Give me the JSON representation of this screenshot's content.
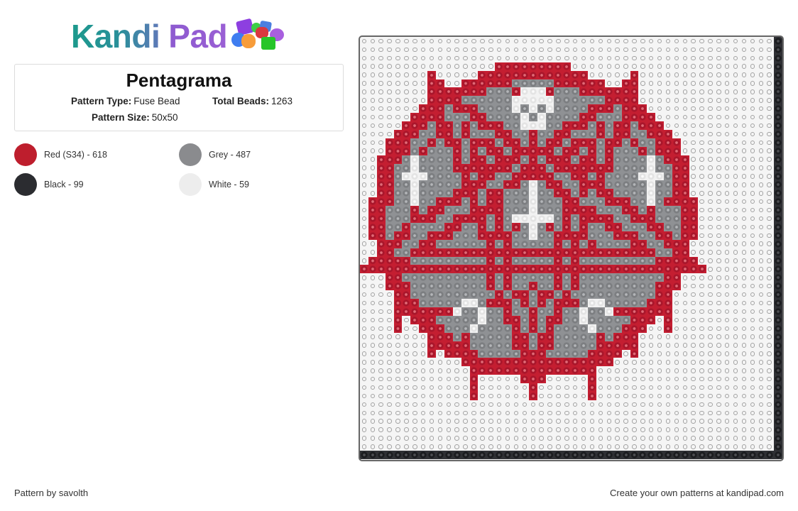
{
  "logo": {
    "part1": "Kandi",
    "part2": "Pad"
  },
  "pattern": {
    "title": "Pentagrama",
    "type_label": "Pattern Type:",
    "type_value": "Fuse Bead",
    "total_label": "Total Beads:",
    "total_value": "1263",
    "size_label": "Pattern Size:",
    "size_value": "50x50"
  },
  "legend": {
    "separator": " - ",
    "items": [
      {
        "key": "R",
        "name": "Red (S34)",
        "count": "618",
        "hex": "#be1e2d"
      },
      {
        "key": "G",
        "name": "Grey",
        "count": "487",
        "hex": "#8a8b8e"
      },
      {
        "key": "K",
        "name": "Black",
        "count": "99",
        "hex": "#2b2c30"
      },
      {
        "key": "W",
        "name": "White",
        "count": "59",
        "hex": "#ededed"
      }
    ]
  },
  "board": {
    "columns": 50,
    "rows_count": 50,
    "key": {
      ".": "empty",
      "R": "Red (S34)",
      "G": "Grey",
      "W": "White",
      "K": "Black"
    },
    "rows": [
      ".......... .......... .......... .......... .........K",
      ".......... .......... .......... .......... .........K",
      ".......... .......... .......... .......... .........K",
      ".......... ......RRRR RRRRR..... .......... .........K",
      "........R. ....RRRRRR RRRRRRR... ..R....... .........K",
      "........RR ..RRRRRRGG GGGRRRRRR. .RR....... .........K",
      "........RR RRRRRGGGRW WWRGGGRRRR RRR....... .........K",
      "........RR RRGGGGGGWW WWWGGGGGGR RRR....... .........K",
      ".......RRR GRRRGGGGWG WGWGGGGRRR GRRR...... .........K",
      "......RRRR GGGRRGGGGW GWGGGGRRGG GRRRR..... .........K",
      ".....RRRGR RGRGRRRGGW WWGGRRRGRG RRGRRR.... .........K",
      "....RRRGGR RGRGGGRRGG RGGRRGGGRG RRGGRRR... .........K",
      "...RRRGGRG RRGRRRGRRG RGRRGRRRGR RGRGGRRR.. .........K",
      "...RRRGRGG GRGRGRRGRR RRRGRRGRGR GGGRGRRR.. .........K",
      "..RRRGWGGG GRGRRGRRRG RGRRRGRRGR GGGGWGRRR. .........K",
      "..RRGGWGGG GRRRRRRRGR RRGRRRRRRR GGGGWGGRR. .........K",
      "..RRGWWWGG GGRGRRGGRR RRRGGRRGRG GGGWWWGRR. .........K",
      "..RRGGWGGG GGRRRGGRRG WGRRGGRRRG GGGGWGGRR. .........K",
      "..RRGGWGGG GRRRGRRGGG WGGRRGRGRR GGGGWGGRR. .........K",
      ".RRRGGWGGR RRGRGRRGGG WGGGRRGGGR RRGGWGRRRR .........K",
      ".RRGGGRGRR GGGRRRRGGG WGGGRRRRGG GRRGRGGGRR .........K",
      ".RRGGGRRRG GRRRRGRGWW WWWGRGRRRR GGRRRGGGRR .........K",
      ".RRGGRGGGG RRGGRGRGRG WGRGRGRGGR RGGGRRGGRR .........K",
      ".RRGRRGGRR RGGGRRRRGG WGGRRRRGGG RRRGGRRGRR .........K",
      "..RRRGGRRG GGGGGRGRGG GGGRGRGRGG GGRRGGRRR. .........K",
      "..RRGGRRRR RRRRRRRRRR RRRRRRRRRR RRRRRGGRR. .........K",
      ".RRRRRGGGG GGGGGRGRGG GGGRGRGGGG GGGGGRRRRR .........K",
      "RRRRRRRRRR RRRRRRRRRR RRRRRRRRRR RRRRRRRRRR R........K",
      "...RRGGGGG GGGGGRGRGG GGGRGRGGGG GGGGGGRR.. .........K",
      "...RRRGGGG GGGGGRGRGG RGGRGRGGGG GGGGGRRR.. .........K",
      "....RRGGGG GGGGGGRGRR GRRGRGGGGG GGGGGRR... .........K",
      "....RRRGGG GGWWGRRRGR GRGRRRGWWG GGGGRRR... .........K",
      "....RRRRRR RWGGWGGRGG RGGRGGWGGW RRRRRRR... .........K",
      "....R.RRRG GGGGWGGRRG RGRRGGWGGG GGRRR.R... .........K",
      "....R..RRR GGGWGGGGRG RGRGGGGWGG GRRR..R... .........K",
      "........RR RGRGGGGGRR GRRGGGGGRG RRR....... .........K",
      "........RR RRRGGGGGRR GRRGGGGGRR RRR....... .........K",
      "........R. RRRRGGGGGR RRGGGGGRRR R.R....... .........K",
      ".......... ..RRRRRRRR RRRRRRRRRR .......... .........K",
      ".......... ...RRRRRRR RRRRRRRR.. .......... .........K",
      ".......... ...R.....R RR.....R.. .......... .........K",
      ".......... ...R...... R......R.. .......... .........K",
      ".......... ...R...... R......R.. .......... .........K",
      ".......... .......... .......... .......... .........K",
      ".......... .......... .......... .......... .........K",
      ".......... .......... .......... .......... .........K",
      ".......... .......... .......... .......... .........K",
      ".......... .......... .......... .......... .........K",
      ".......... .......... .......... .......... .........K",
      "KKKKKKKKKK KKKKKKKKKK KKKKKKKKKK KKKKKKKKKK KKKKKKKKKK"
    ]
  },
  "footer": {
    "credit": "Pattern by savolth",
    "cta": "Create your own patterns at kandipad.com"
  }
}
